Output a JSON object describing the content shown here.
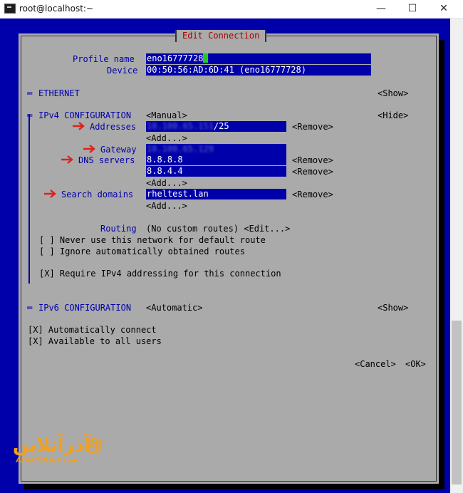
{
  "window": {
    "title": "root@localhost:~",
    "controls": {
      "minimize": "—",
      "maximize": "☐",
      "close": "✕"
    }
  },
  "dialog": {
    "title": "Edit Connection",
    "profile_name_label": "Profile name",
    "profile_name_value": "eno16777728",
    "device_label": "Device",
    "device_value": "00:50:56:AD:6D:41 (eno16777728)",
    "ethernet": {
      "marker": "═",
      "label": "ETHERNET",
      "toggle": "<Show>"
    },
    "ipv4": {
      "marker": "╤",
      "label": "IPv4 CONFIGURATION",
      "mode": "<Manual>",
      "toggle": "<Hide>",
      "addresses_label": "Addresses",
      "address_value_blurred": "10.100.65.151",
      "address_suffix": "/25",
      "gateway_label": "Gateway",
      "gateway_value_blurred": "10.100.65.129",
      "dns_label": "DNS servers",
      "dns_servers": [
        "8.8.8.8",
        "8.8.4.4"
      ],
      "search_label": "Search domains",
      "search_domain": "rheltest.lan",
      "remove": "<Remove>",
      "add": "<Add...>",
      "routing_label": "Routing",
      "routing_value": "(No custom routes) <Edit...>",
      "never_default": "[ ] Never use this network for default route",
      "ignore_routes": "[ ] Ignore automatically obtained routes",
      "require_ipv4": "[X] Require IPv4 addressing for this connection"
    },
    "ipv6": {
      "marker": "═",
      "label": "IPv6 CONFIGURATION",
      "mode": "<Automatic>",
      "toggle": "<Show>"
    },
    "auto_connect": "[X] Automatically connect",
    "all_users": "[X] Available to all users",
    "cancel": "<Cancel>",
    "ok": "<OK>"
  },
  "watermark": {
    "text": "آذرآنلاین",
    "sub": "AZARONLINE.com"
  },
  "colors": {
    "terminal_bg": "#0000aa",
    "dialog_bg": "#aaaaaa",
    "title_red": "#aa0000",
    "arrow_red": "#e02020",
    "cursor_green": "#22cc22",
    "logo_orange": "#f0a020"
  },
  "icons": {
    "arrow": "red-arrow-icon",
    "app": "terminal-app-icon"
  }
}
